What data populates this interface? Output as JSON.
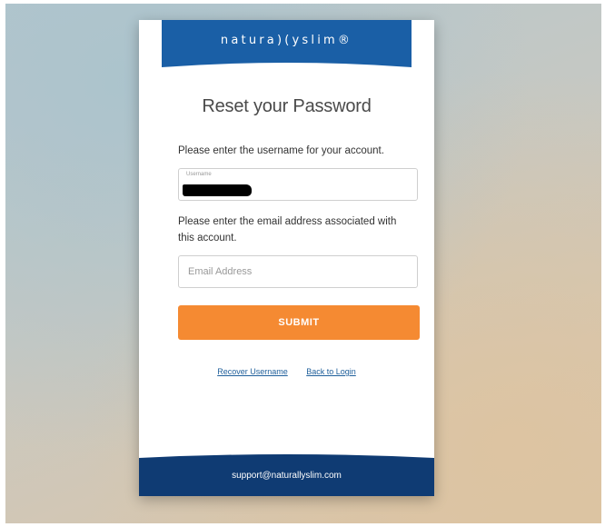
{
  "brand": {
    "logo_text": "natura)(yslim®",
    "primary_color": "#1a5fa6",
    "footer_color": "#0f3b73",
    "accent_color": "#f58a32"
  },
  "form": {
    "title": "Reset your Password",
    "username_prompt": "Please enter the username for your account.",
    "username_label": "Username",
    "username_value_redacted": true,
    "email_prompt": "Please enter the email address associated with this account.",
    "email_placeholder": "Email Address",
    "email_value": "",
    "submit_label": "SUBMIT"
  },
  "links": {
    "recover_username": "Recover Username",
    "back_to_login": "Back to Login"
  },
  "footer": {
    "support_email": "support@naturallyslim.com"
  }
}
